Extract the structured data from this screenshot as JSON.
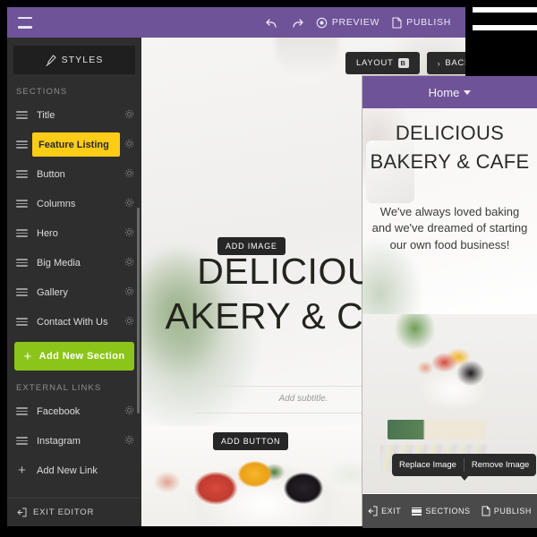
{
  "topbar": {
    "menu_icon": "hamburger-icon",
    "undo_icon": "undo-arrow-icon",
    "redo_icon": "redo-arrow-icon",
    "preview_label": "PREVIEW",
    "publish_label": "PUBLISH",
    "background_color": "#6f5399"
  },
  "sidebar": {
    "styles_label": "STYLES",
    "sections_heading": "SECTIONS",
    "sections": [
      {
        "label": "Title",
        "active": false
      },
      {
        "label": "Feature Listing",
        "active": true
      },
      {
        "label": "Button",
        "active": false
      },
      {
        "label": "Columns",
        "active": false
      },
      {
        "label": "Hero",
        "active": false
      },
      {
        "label": "Big Media",
        "active": false
      },
      {
        "label": "Gallery",
        "active": false
      },
      {
        "label": "Contact With Us",
        "active": false
      }
    ],
    "add_section_label": "Add New Section",
    "add_section_color": "#8cc519",
    "external_links_heading": "EXTERNAL LINKS",
    "links": [
      {
        "label": "Facebook"
      },
      {
        "label": "Instagram"
      }
    ],
    "add_new_link_label": "Add New Link",
    "exit_editor_label": "EXIT EDITOR",
    "active_highlight_color": "#fdcc16"
  },
  "canvas": {
    "layout_label": "LAYOUT",
    "layout_shortcut": "B",
    "background_label": "BACKGROUND",
    "add_image_label": "ADD IMAGE",
    "add_button_label": "ADD BUTTON",
    "headline_line1": "DELICIOUS.",
    "headline_line2": "AKERY & CAFE",
    "subtitle_placeholder": "Add subtitle."
  },
  "mobile": {
    "nav_title": "Home",
    "heading_line1": "DELICIOUS",
    "heading_line2": "BAKERY & CAFE",
    "body_text": "We've always loved baking and we've dreamed of starting our own food business!",
    "tooltip": {
      "replace_label": "Replace Image",
      "remove_label": "Remove Image"
    },
    "bottom_bar": {
      "exit_label": "EXIT",
      "sections_label": "SECTIONS",
      "publish_label": "PUBLISH"
    }
  }
}
